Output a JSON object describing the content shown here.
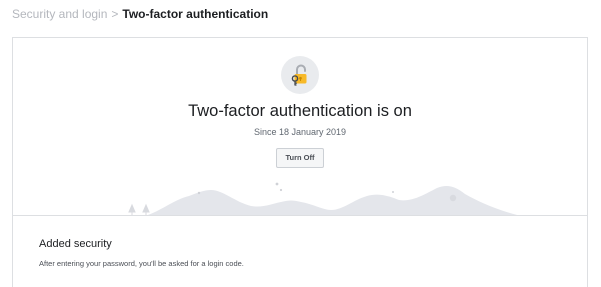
{
  "breadcrumb": {
    "parent": "Security and login",
    "separator": ">",
    "current": "Two-factor authentication"
  },
  "status": {
    "icon": "unlocked-padlock-with-key-icon",
    "title": "Two-factor authentication is on",
    "since": "Since 18 January 2019",
    "turn_off_label": "Turn Off"
  },
  "added_security": {
    "title": "Added security",
    "description": "After entering your password, you'll be asked for a login code."
  },
  "colors": {
    "lock_body": "#f7b928",
    "lock_shackle": "#a9adb3",
    "icon_circle": "#e9ebee",
    "hills": "#e4e6eb",
    "card_border": "#dddfe2",
    "breadcrumb_link": "#b4b7bd"
  }
}
